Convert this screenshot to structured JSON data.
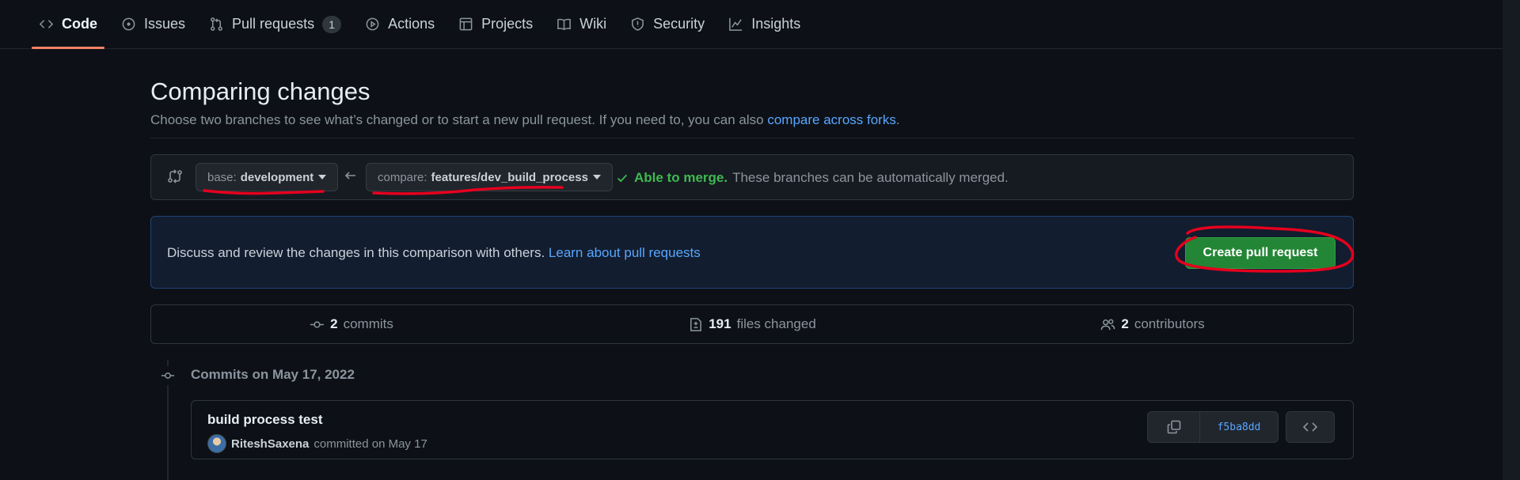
{
  "tabs": [
    {
      "label": "Code",
      "icon": "code-icon",
      "selected": true
    },
    {
      "label": "Issues",
      "icon": "issue-opened-icon"
    },
    {
      "label": "Pull requests",
      "icon": "git-pull-request-icon",
      "counter": "1"
    },
    {
      "label": "Actions",
      "icon": "play-icon"
    },
    {
      "label": "Projects",
      "icon": "table-icon"
    },
    {
      "label": "Wiki",
      "icon": "book-icon"
    },
    {
      "label": "Security",
      "icon": "shield-icon"
    },
    {
      "label": "Insights",
      "icon": "graph-icon"
    }
  ],
  "compare": {
    "title": "Comparing changes",
    "subtitle": "Choose two branches to see what’s changed or to start a new pull request. If you need to, you can also",
    "subtitle_link": "compare across forks",
    "subtitle_end": "."
  },
  "range": {
    "base_prefix": "base:",
    "base_branch": "development",
    "compare_prefix": "compare:",
    "compare_branch": "features/dev_build_process",
    "merge_ok": "Able to merge.",
    "merge_text": "These branches can be automatically merged."
  },
  "flash": {
    "text": "Discuss and review the changes in this comparison with others.",
    "link": "Learn about pull requests",
    "button": "Create pull request"
  },
  "summary": {
    "commits_count": "2",
    "commits_label": "commits",
    "files_count": "191",
    "files_label": "files changed",
    "contributors_count": "2",
    "contributors_label": "contributors"
  },
  "commits_heading": "Commits on May 17, 2022",
  "commit": {
    "title": "build process test",
    "author": "RiteshSaxena",
    "meta": "committed on May 17",
    "sha": "f5ba8dd"
  },
  "colors": {
    "accent_link": "#58a6ff",
    "success": "#3fb950",
    "primary_button": "#238636",
    "selected_tab_underline": "#f78166",
    "annotation": "#e5001e"
  }
}
